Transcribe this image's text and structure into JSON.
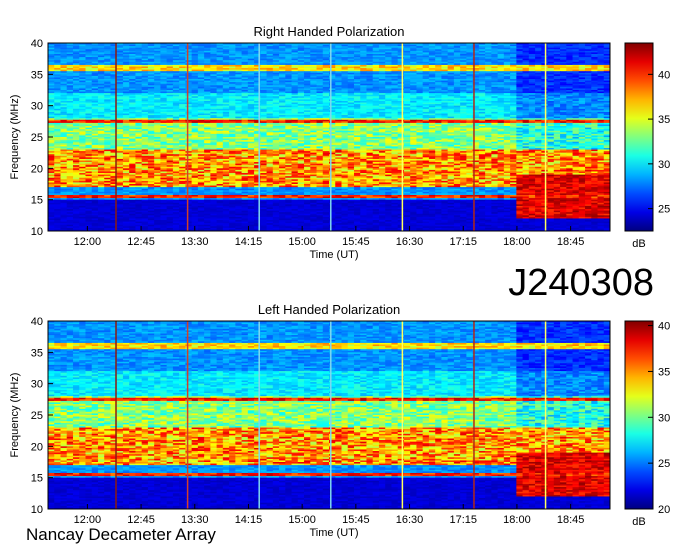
{
  "header": {
    "observation_id": "J240308"
  },
  "footer": {
    "instrument": "Nancay Decameter Array"
  },
  "chart_data": [
    {
      "type": "heatmap",
      "title": "Right Handed Polarization",
      "xlabel": "Time (UT)",
      "ylabel": "Frequency (MHz)",
      "x_ticks": [
        "12:00",
        "12:45",
        "13:30",
        "14:15",
        "15:00",
        "15:45",
        "16:30",
        "17:15",
        "18:00",
        "18:45"
      ],
      "x_tick_hours": [
        12.0,
        12.75,
        13.5,
        14.25,
        15.0,
        15.75,
        16.5,
        17.25,
        18.0,
        18.75
      ],
      "xlim_hours": [
        11.45,
        19.3
      ],
      "y_ticks": [
        10,
        15,
        20,
        25,
        30,
        35,
        40
      ],
      "ylim": [
        10,
        40
      ],
      "colorbar": {
        "label": "dB",
        "ticks": [
          25,
          30,
          35,
          40
        ],
        "range": [
          22.5,
          43.5
        ]
      },
      "vertical_lines": [
        {
          "time_hours": 12.4,
          "color": "#8c1a10"
        },
        {
          "time_hours": 13.4,
          "color": "#d24028"
        },
        {
          "time_hours": 14.4,
          "color": "#7fd8f0"
        },
        {
          "time_hours": 15.4,
          "color": "#7fd8f0"
        },
        {
          "time_hours": 16.4,
          "color": "#ffff60"
        },
        {
          "time_hours": 17.4,
          "color": "#b02818"
        },
        {
          "time_hours": 18.4,
          "color": "#ffff60"
        }
      ],
      "banding": {
        "strong_emission_mhz": [
          17,
          23
        ],
        "moderate_emission_mhz": [
          24,
          28
        ],
        "quiet_low_band_below_mhz": 15,
        "late_burst_start_hours": 18.0
      }
    },
    {
      "type": "heatmap",
      "title": "Left Handed Polarization",
      "xlabel": "Time (UT)",
      "ylabel": "Frequency (MHz)",
      "x_ticks": [
        "12:00",
        "12:45",
        "13:30",
        "14:15",
        "15:00",
        "15:45",
        "16:30",
        "17:15",
        "18:00",
        "18:45"
      ],
      "x_tick_hours": [
        12.0,
        12.75,
        13.5,
        14.25,
        15.0,
        15.75,
        16.5,
        17.25,
        18.0,
        18.75
      ],
      "xlim_hours": [
        11.45,
        19.3
      ],
      "y_ticks": [
        10,
        15,
        20,
        25,
        30,
        35,
        40
      ],
      "ylim": [
        10,
        40
      ],
      "colorbar": {
        "label": "dB",
        "ticks": [
          20,
          25,
          30,
          35,
          40
        ],
        "range": [
          20,
          40.5
        ]
      },
      "vertical_lines": [
        {
          "time_hours": 12.4,
          "color": "#8c1a10"
        },
        {
          "time_hours": 13.4,
          "color": "#d24028"
        },
        {
          "time_hours": 14.4,
          "color": "#7fd8f0"
        },
        {
          "time_hours": 15.4,
          "color": "#7fd8f0"
        },
        {
          "time_hours": 16.4,
          "color": "#ffff60"
        },
        {
          "time_hours": 17.4,
          "color": "#b02818"
        },
        {
          "time_hours": 18.4,
          "color": "#ffff60"
        }
      ],
      "banding": {
        "strong_emission_mhz": [
          17,
          23
        ],
        "moderate_emission_mhz": [
          24,
          28
        ],
        "quiet_low_band_below_mhz": 15,
        "late_burst_start_hours": 18.0
      }
    }
  ]
}
